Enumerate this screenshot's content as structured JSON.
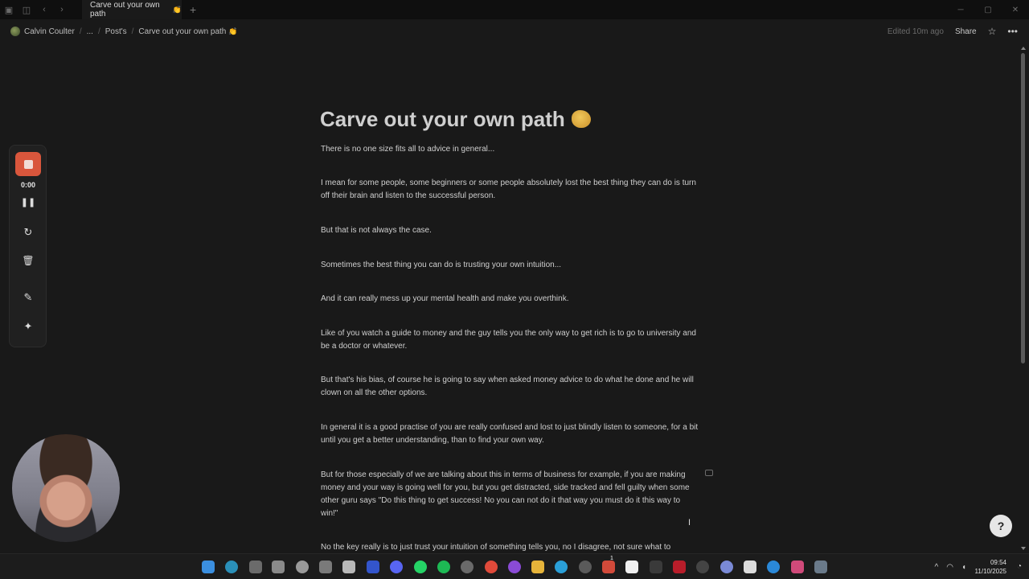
{
  "window": {
    "tab_title": "Carve out your own path",
    "tab_emoji": "👏",
    "new_tab": "+",
    "controls": {
      "minimize": "─",
      "maximize": "▢",
      "close": "✕"
    }
  },
  "breadcrumb": {
    "workspace": "Calvin Coulter",
    "ellipsis": "...",
    "parent": "Post's",
    "current": "Carve out your own path",
    "current_emoji": "👏",
    "sep": "/"
  },
  "header_actions": {
    "edited": "Edited 10m ago",
    "share": "Share",
    "star": "☆",
    "more": "•••"
  },
  "recorder": {
    "time": "0:00",
    "pause": "❚❚",
    "restart": "↻",
    "delete": "🗑",
    "draw": "✎",
    "effects": "✦"
  },
  "document": {
    "title": "Carve out your own path",
    "paragraphs": [
      "There is no one size fits all to advice in general...",
      "I mean for some people, some beginners or some people absolutely lost the best thing they can do is turn off their brain and listen to the successful person.",
      "But that is not always the case.",
      "Sometimes the best thing you can do is trusting your own intuition...",
      "And it can really mess up your mental health and make you overthink.",
      "Like of you watch a guide to money and the guy tells you the only way to get rich is to go to university and be a doctor or whatever.",
      "But that's his bias, of course he is going to say when asked money advice to do what he done and he will clown on all the other options.",
      "In general it is a good practise of you are really confused and lost to just blindly listen to someone, for a bit until you get a better understanding, than to find your own way.",
      "But for those especially of we are talking about this in terms of business for example, if you are making money and your way is going well for you, but you get distracted, side tracked and fell guilty when some other guru says \"Do this thing to get success! No you can not do it that way you must do it this way to win!\"",
      "No the key really is to just trust your intuition of something tells you, no I disagree, not sure what to"
    ]
  },
  "help_label": "?",
  "cursor": "I",
  "taskbar": {
    "tray_chevron": "^",
    "wifi": "◠",
    "volume": "◖",
    "time": "09:54",
    "date": "11/10/2025",
    "notification_badge": "1"
  },
  "colors": {
    "background": "#191919",
    "record_red": "#d9563c",
    "windows_blue": "#3b8fe0"
  }
}
